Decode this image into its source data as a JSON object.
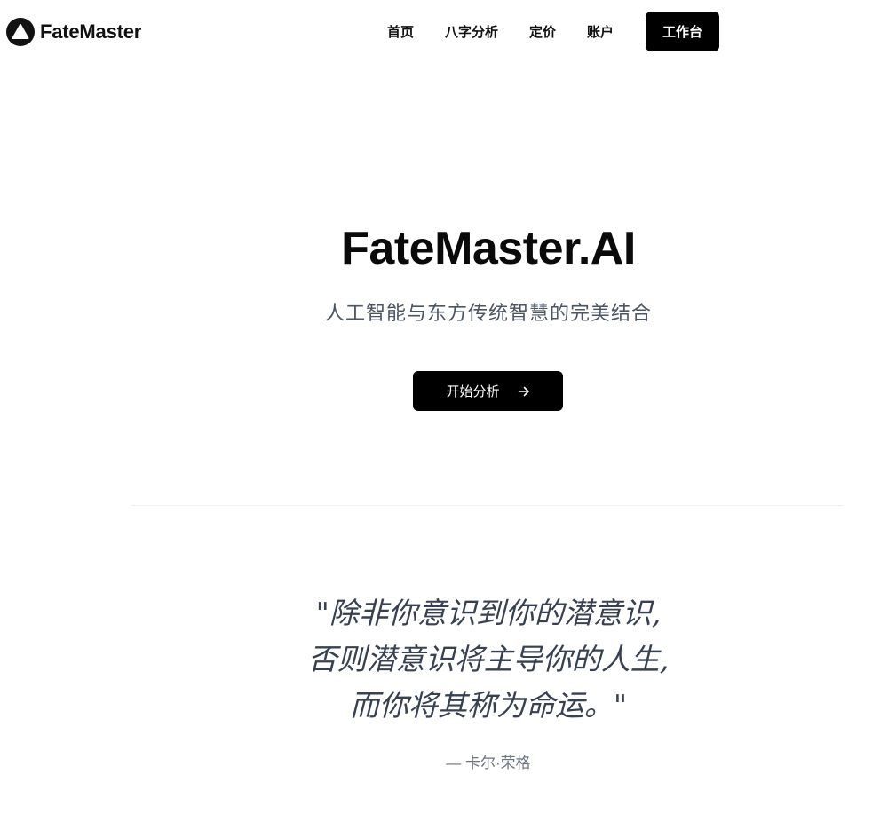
{
  "brand": {
    "name": "FateMaster",
    "logo_icon": "triangle-up-icon"
  },
  "nav": {
    "items": [
      {
        "label": "首页"
      },
      {
        "label": "八字分析"
      },
      {
        "label": "定价"
      },
      {
        "label": "账户"
      }
    ],
    "cta_label": "工作台"
  },
  "hero": {
    "title": "FateMaster.AI",
    "subtitle": "人工智能与东方传统智慧的完美结合",
    "cta_label": "开始分析",
    "cta_icon": "arrow-right-icon"
  },
  "quote": {
    "lines": [
      "\"除非你意识到你的潜意识,",
      "否则潜意识将主导你的人生,",
      "而你将其称为命运。\""
    ],
    "author": "— 卡尔·荣格"
  },
  "colors": {
    "primary": "#000000",
    "text": "#111111",
    "subtitle": "#4b5563",
    "quote": "#374151",
    "muted": "#6b7280",
    "background": "#ffffff"
  }
}
